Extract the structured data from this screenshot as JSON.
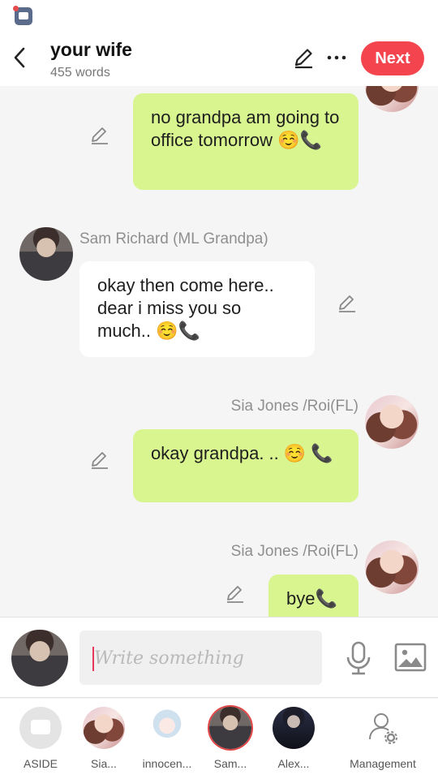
{
  "header": {
    "title": "your wife",
    "subtitle": "455 words",
    "next_label": "Next"
  },
  "messages": [
    {
      "side": "right",
      "sender": "",
      "text": "no grandpa am going to office tomorrow ☺️📞",
      "bubble_color": "#d8f58f"
    },
    {
      "side": "left",
      "sender": "Sam Richard  (ML Grandpa)",
      "text": "okay then come here.. dear i miss you so much.. ☺️📞",
      "bubble_color": "#ffffff"
    },
    {
      "side": "right",
      "sender": "Sia Jones /Roi(FL)",
      "text": "okay grandpa. ..  ☺️ 📞",
      "bubble_color": "#d8f58f"
    },
    {
      "side": "right",
      "sender": "Sia Jones /Roi(FL)",
      "text": "bye📞",
      "bubble_color": "#d8f58f"
    }
  ],
  "composer": {
    "placeholder": "Write something"
  },
  "bottom_nav": {
    "items": [
      {
        "label": "ASIDE",
        "icon": "aside-icon"
      },
      {
        "label": "Sia...",
        "icon": "avatar"
      },
      {
        "label": "innocen...",
        "icon": "avatar"
      },
      {
        "label": "Sam...",
        "icon": "avatar",
        "selected": true
      },
      {
        "label": "Alex...",
        "icon": "avatar"
      },
      {
        "label": "Management",
        "icon": "management-icon"
      }
    ]
  },
  "colors": {
    "accent": "#f4454e",
    "bubble_self": "#d8f58f",
    "bubble_other": "#ffffff"
  }
}
